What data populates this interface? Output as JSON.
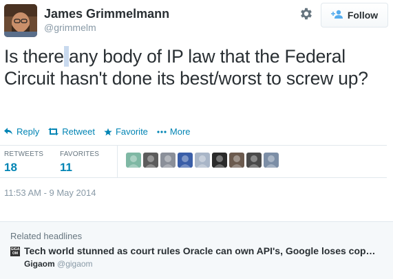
{
  "author": {
    "name": "James Grimmelmann",
    "handle": "@grimmelm"
  },
  "follow": {
    "label": "Follow"
  },
  "tweet": {
    "text_before": "Is there",
    "text_highlight": " ",
    "text_after": "any body of IP law that the Federal Circuit hasn't done its best/worst to screw up?"
  },
  "actions": [
    {
      "label": "Reply",
      "icon": "reply-icon"
    },
    {
      "label": "Retweet",
      "icon": "retweet-icon"
    },
    {
      "label": "Favorite",
      "icon": "star-icon"
    },
    {
      "label": "More",
      "icon": "dots-icon"
    }
  ],
  "stats": {
    "retweets_label": "RETWEETS",
    "retweets_value": "18",
    "favorites_label": "FAVORITES",
    "favorites_value": "11"
  },
  "faces": [
    "#7fb8a4",
    "#5c5c5c",
    "#8a8f99",
    "#3a5ea8",
    "#a9b6c8",
    "#2b2b2b",
    "#6b5a4e",
    "#4a4a4a",
    "#7c8ea6"
  ],
  "timestamp": "11:53 AM - 9 May 2014",
  "related": {
    "title": "Related headlines",
    "icon_text": "GIGA OM",
    "headline": "Tech world stunned as court rules Oracle can own API's, Google loses cop…",
    "source_name": "Gigaom",
    "source_handle": "@gigaom"
  },
  "colors": {
    "link": "#0084b4",
    "text": "#292f33",
    "muted": "#8899a6",
    "border": "#e1e8ed"
  }
}
